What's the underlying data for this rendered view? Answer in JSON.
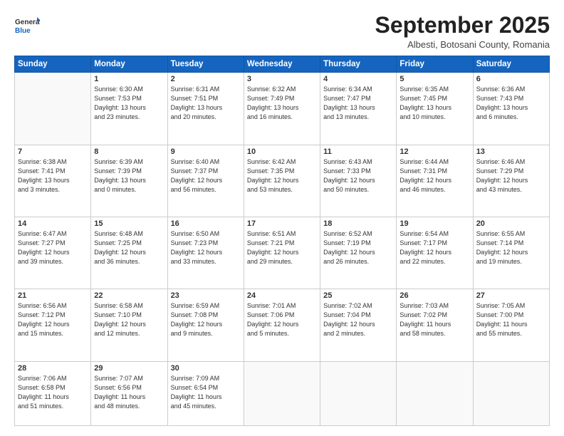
{
  "logo": {
    "general": "General",
    "blue": "Blue"
  },
  "header": {
    "title": "September 2025",
    "subtitle": "Albesti, Botosani County, Romania"
  },
  "days_of_week": [
    "Sunday",
    "Monday",
    "Tuesday",
    "Wednesday",
    "Thursday",
    "Friday",
    "Saturday"
  ],
  "weeks": [
    [
      {
        "day": "",
        "info": ""
      },
      {
        "day": "1",
        "info": "Sunrise: 6:30 AM\nSunset: 7:53 PM\nDaylight: 13 hours\nand 23 minutes."
      },
      {
        "day": "2",
        "info": "Sunrise: 6:31 AM\nSunset: 7:51 PM\nDaylight: 13 hours\nand 20 minutes."
      },
      {
        "day": "3",
        "info": "Sunrise: 6:32 AM\nSunset: 7:49 PM\nDaylight: 13 hours\nand 16 minutes."
      },
      {
        "day": "4",
        "info": "Sunrise: 6:34 AM\nSunset: 7:47 PM\nDaylight: 13 hours\nand 13 minutes."
      },
      {
        "day": "5",
        "info": "Sunrise: 6:35 AM\nSunset: 7:45 PM\nDaylight: 13 hours\nand 10 minutes."
      },
      {
        "day": "6",
        "info": "Sunrise: 6:36 AM\nSunset: 7:43 PM\nDaylight: 13 hours\nand 6 minutes."
      }
    ],
    [
      {
        "day": "7",
        "info": "Sunrise: 6:38 AM\nSunset: 7:41 PM\nDaylight: 13 hours\nand 3 minutes."
      },
      {
        "day": "8",
        "info": "Sunrise: 6:39 AM\nSunset: 7:39 PM\nDaylight: 13 hours\nand 0 minutes."
      },
      {
        "day": "9",
        "info": "Sunrise: 6:40 AM\nSunset: 7:37 PM\nDaylight: 12 hours\nand 56 minutes."
      },
      {
        "day": "10",
        "info": "Sunrise: 6:42 AM\nSunset: 7:35 PM\nDaylight: 12 hours\nand 53 minutes."
      },
      {
        "day": "11",
        "info": "Sunrise: 6:43 AM\nSunset: 7:33 PM\nDaylight: 12 hours\nand 50 minutes."
      },
      {
        "day": "12",
        "info": "Sunrise: 6:44 AM\nSunset: 7:31 PM\nDaylight: 12 hours\nand 46 minutes."
      },
      {
        "day": "13",
        "info": "Sunrise: 6:46 AM\nSunset: 7:29 PM\nDaylight: 12 hours\nand 43 minutes."
      }
    ],
    [
      {
        "day": "14",
        "info": "Sunrise: 6:47 AM\nSunset: 7:27 PM\nDaylight: 12 hours\nand 39 minutes."
      },
      {
        "day": "15",
        "info": "Sunrise: 6:48 AM\nSunset: 7:25 PM\nDaylight: 12 hours\nand 36 minutes."
      },
      {
        "day": "16",
        "info": "Sunrise: 6:50 AM\nSunset: 7:23 PM\nDaylight: 12 hours\nand 33 minutes."
      },
      {
        "day": "17",
        "info": "Sunrise: 6:51 AM\nSunset: 7:21 PM\nDaylight: 12 hours\nand 29 minutes."
      },
      {
        "day": "18",
        "info": "Sunrise: 6:52 AM\nSunset: 7:19 PM\nDaylight: 12 hours\nand 26 minutes."
      },
      {
        "day": "19",
        "info": "Sunrise: 6:54 AM\nSunset: 7:17 PM\nDaylight: 12 hours\nand 22 minutes."
      },
      {
        "day": "20",
        "info": "Sunrise: 6:55 AM\nSunset: 7:14 PM\nDaylight: 12 hours\nand 19 minutes."
      }
    ],
    [
      {
        "day": "21",
        "info": "Sunrise: 6:56 AM\nSunset: 7:12 PM\nDaylight: 12 hours\nand 15 minutes."
      },
      {
        "day": "22",
        "info": "Sunrise: 6:58 AM\nSunset: 7:10 PM\nDaylight: 12 hours\nand 12 minutes."
      },
      {
        "day": "23",
        "info": "Sunrise: 6:59 AM\nSunset: 7:08 PM\nDaylight: 12 hours\nand 9 minutes."
      },
      {
        "day": "24",
        "info": "Sunrise: 7:01 AM\nSunset: 7:06 PM\nDaylight: 12 hours\nand 5 minutes."
      },
      {
        "day": "25",
        "info": "Sunrise: 7:02 AM\nSunset: 7:04 PM\nDaylight: 12 hours\nand 2 minutes."
      },
      {
        "day": "26",
        "info": "Sunrise: 7:03 AM\nSunset: 7:02 PM\nDaylight: 11 hours\nand 58 minutes."
      },
      {
        "day": "27",
        "info": "Sunrise: 7:05 AM\nSunset: 7:00 PM\nDaylight: 11 hours\nand 55 minutes."
      }
    ],
    [
      {
        "day": "28",
        "info": "Sunrise: 7:06 AM\nSunset: 6:58 PM\nDaylight: 11 hours\nand 51 minutes."
      },
      {
        "day": "29",
        "info": "Sunrise: 7:07 AM\nSunset: 6:56 PM\nDaylight: 11 hours\nand 48 minutes."
      },
      {
        "day": "30",
        "info": "Sunrise: 7:09 AM\nSunset: 6:54 PM\nDaylight: 11 hours\nand 45 minutes."
      },
      {
        "day": "",
        "info": ""
      },
      {
        "day": "",
        "info": ""
      },
      {
        "day": "",
        "info": ""
      },
      {
        "day": "",
        "info": ""
      }
    ]
  ]
}
